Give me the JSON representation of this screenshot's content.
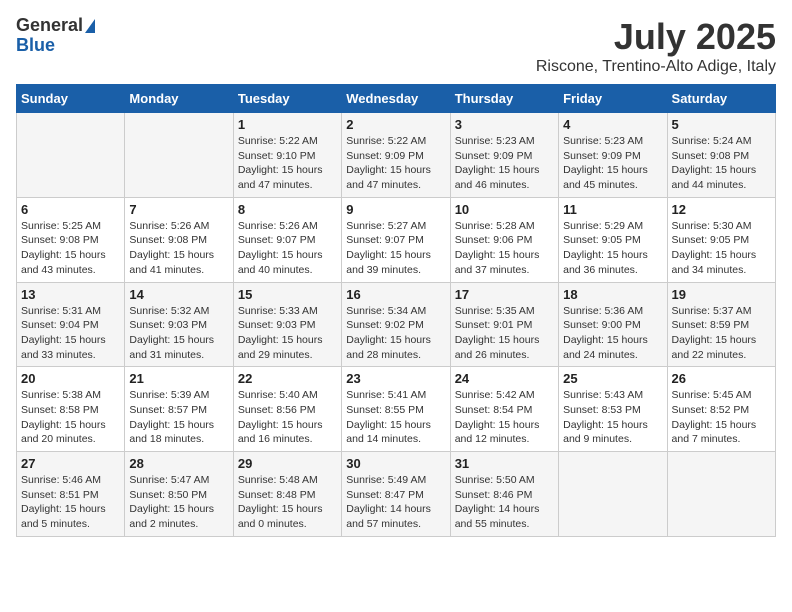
{
  "header": {
    "logo_line1": "General",
    "logo_line2": "Blue",
    "title": "July 2025",
    "subtitle": "Riscone, Trentino-Alto Adige, Italy"
  },
  "weekdays": [
    "Sunday",
    "Monday",
    "Tuesday",
    "Wednesday",
    "Thursday",
    "Friday",
    "Saturday"
  ],
  "weeks": [
    [
      {
        "day": "",
        "sunrise": "",
        "sunset": "",
        "daylight": ""
      },
      {
        "day": "",
        "sunrise": "",
        "sunset": "",
        "daylight": ""
      },
      {
        "day": "1",
        "sunrise": "Sunrise: 5:22 AM",
        "sunset": "Sunset: 9:10 PM",
        "daylight": "Daylight: 15 hours and 47 minutes."
      },
      {
        "day": "2",
        "sunrise": "Sunrise: 5:22 AM",
        "sunset": "Sunset: 9:09 PM",
        "daylight": "Daylight: 15 hours and 47 minutes."
      },
      {
        "day": "3",
        "sunrise": "Sunrise: 5:23 AM",
        "sunset": "Sunset: 9:09 PM",
        "daylight": "Daylight: 15 hours and 46 minutes."
      },
      {
        "day": "4",
        "sunrise": "Sunrise: 5:23 AM",
        "sunset": "Sunset: 9:09 PM",
        "daylight": "Daylight: 15 hours and 45 minutes."
      },
      {
        "day": "5",
        "sunrise": "Sunrise: 5:24 AM",
        "sunset": "Sunset: 9:08 PM",
        "daylight": "Daylight: 15 hours and 44 minutes."
      }
    ],
    [
      {
        "day": "6",
        "sunrise": "Sunrise: 5:25 AM",
        "sunset": "Sunset: 9:08 PM",
        "daylight": "Daylight: 15 hours and 43 minutes."
      },
      {
        "day": "7",
        "sunrise": "Sunrise: 5:26 AM",
        "sunset": "Sunset: 9:08 PM",
        "daylight": "Daylight: 15 hours and 41 minutes."
      },
      {
        "day": "8",
        "sunrise": "Sunrise: 5:26 AM",
        "sunset": "Sunset: 9:07 PM",
        "daylight": "Daylight: 15 hours and 40 minutes."
      },
      {
        "day": "9",
        "sunrise": "Sunrise: 5:27 AM",
        "sunset": "Sunset: 9:07 PM",
        "daylight": "Daylight: 15 hours and 39 minutes."
      },
      {
        "day": "10",
        "sunrise": "Sunrise: 5:28 AM",
        "sunset": "Sunset: 9:06 PM",
        "daylight": "Daylight: 15 hours and 37 minutes."
      },
      {
        "day": "11",
        "sunrise": "Sunrise: 5:29 AM",
        "sunset": "Sunset: 9:05 PM",
        "daylight": "Daylight: 15 hours and 36 minutes."
      },
      {
        "day": "12",
        "sunrise": "Sunrise: 5:30 AM",
        "sunset": "Sunset: 9:05 PM",
        "daylight": "Daylight: 15 hours and 34 minutes."
      }
    ],
    [
      {
        "day": "13",
        "sunrise": "Sunrise: 5:31 AM",
        "sunset": "Sunset: 9:04 PM",
        "daylight": "Daylight: 15 hours and 33 minutes."
      },
      {
        "day": "14",
        "sunrise": "Sunrise: 5:32 AM",
        "sunset": "Sunset: 9:03 PM",
        "daylight": "Daylight: 15 hours and 31 minutes."
      },
      {
        "day": "15",
        "sunrise": "Sunrise: 5:33 AM",
        "sunset": "Sunset: 9:03 PM",
        "daylight": "Daylight: 15 hours and 29 minutes."
      },
      {
        "day": "16",
        "sunrise": "Sunrise: 5:34 AM",
        "sunset": "Sunset: 9:02 PM",
        "daylight": "Daylight: 15 hours and 28 minutes."
      },
      {
        "day": "17",
        "sunrise": "Sunrise: 5:35 AM",
        "sunset": "Sunset: 9:01 PM",
        "daylight": "Daylight: 15 hours and 26 minutes."
      },
      {
        "day": "18",
        "sunrise": "Sunrise: 5:36 AM",
        "sunset": "Sunset: 9:00 PM",
        "daylight": "Daylight: 15 hours and 24 minutes."
      },
      {
        "day": "19",
        "sunrise": "Sunrise: 5:37 AM",
        "sunset": "Sunset: 8:59 PM",
        "daylight": "Daylight: 15 hours and 22 minutes."
      }
    ],
    [
      {
        "day": "20",
        "sunrise": "Sunrise: 5:38 AM",
        "sunset": "Sunset: 8:58 PM",
        "daylight": "Daylight: 15 hours and 20 minutes."
      },
      {
        "day": "21",
        "sunrise": "Sunrise: 5:39 AM",
        "sunset": "Sunset: 8:57 PM",
        "daylight": "Daylight: 15 hours and 18 minutes."
      },
      {
        "day": "22",
        "sunrise": "Sunrise: 5:40 AM",
        "sunset": "Sunset: 8:56 PM",
        "daylight": "Daylight: 15 hours and 16 minutes."
      },
      {
        "day": "23",
        "sunrise": "Sunrise: 5:41 AM",
        "sunset": "Sunset: 8:55 PM",
        "daylight": "Daylight: 15 hours and 14 minutes."
      },
      {
        "day": "24",
        "sunrise": "Sunrise: 5:42 AM",
        "sunset": "Sunset: 8:54 PM",
        "daylight": "Daylight: 15 hours and 12 minutes."
      },
      {
        "day": "25",
        "sunrise": "Sunrise: 5:43 AM",
        "sunset": "Sunset: 8:53 PM",
        "daylight": "Daylight: 15 hours and 9 minutes."
      },
      {
        "day": "26",
        "sunrise": "Sunrise: 5:45 AM",
        "sunset": "Sunset: 8:52 PM",
        "daylight": "Daylight: 15 hours and 7 minutes."
      }
    ],
    [
      {
        "day": "27",
        "sunrise": "Sunrise: 5:46 AM",
        "sunset": "Sunset: 8:51 PM",
        "daylight": "Daylight: 15 hours and 5 minutes."
      },
      {
        "day": "28",
        "sunrise": "Sunrise: 5:47 AM",
        "sunset": "Sunset: 8:50 PM",
        "daylight": "Daylight: 15 hours and 2 minutes."
      },
      {
        "day": "29",
        "sunrise": "Sunrise: 5:48 AM",
        "sunset": "Sunset: 8:48 PM",
        "daylight": "Daylight: 15 hours and 0 minutes."
      },
      {
        "day": "30",
        "sunrise": "Sunrise: 5:49 AM",
        "sunset": "Sunset: 8:47 PM",
        "daylight": "Daylight: 14 hours and 57 minutes."
      },
      {
        "day": "31",
        "sunrise": "Sunrise: 5:50 AM",
        "sunset": "Sunset: 8:46 PM",
        "daylight": "Daylight: 14 hours and 55 minutes."
      },
      {
        "day": "",
        "sunrise": "",
        "sunset": "",
        "daylight": ""
      },
      {
        "day": "",
        "sunrise": "",
        "sunset": "",
        "daylight": ""
      }
    ]
  ]
}
